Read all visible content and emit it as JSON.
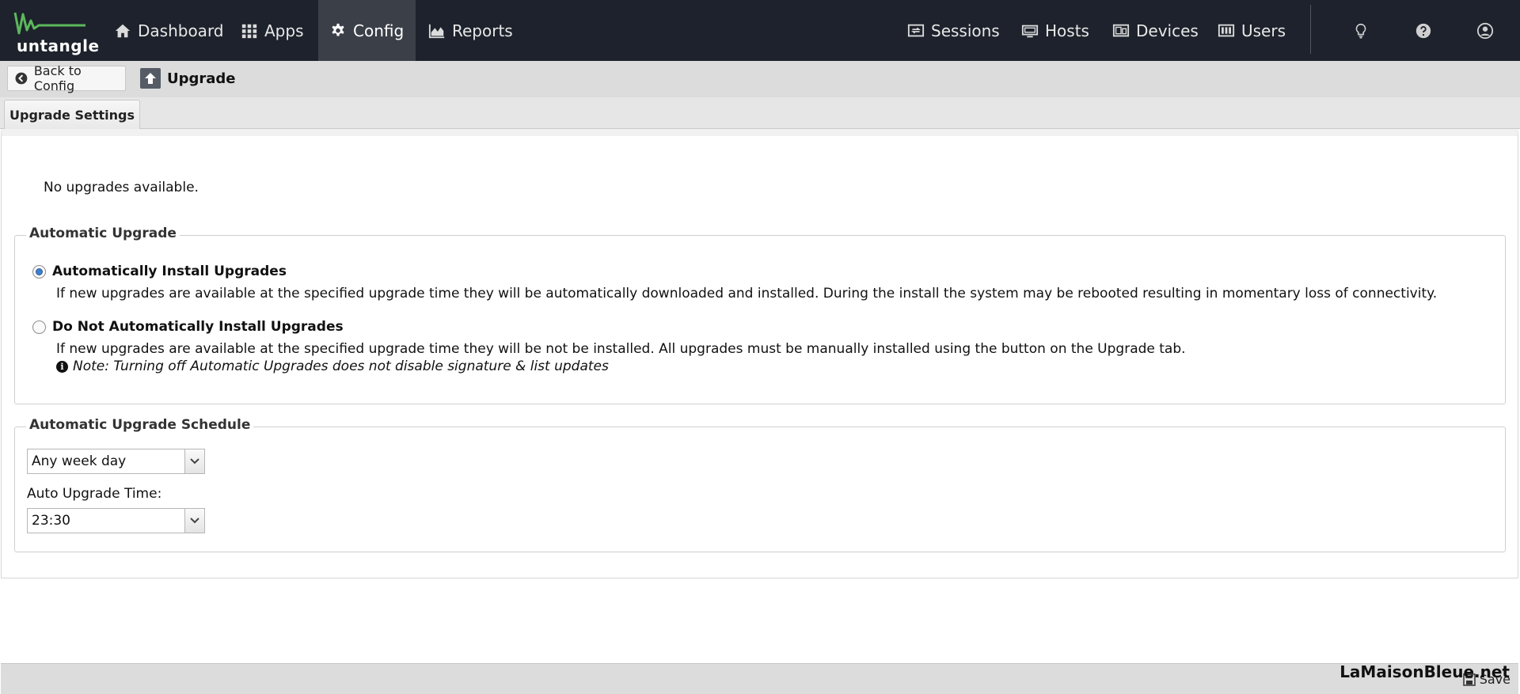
{
  "topbar": {
    "logo_text": "untangle",
    "nav": [
      {
        "label": "Dashboard",
        "icon": "home-icon"
      },
      {
        "label": "Apps",
        "icon": "grid-icon"
      },
      {
        "label": "Config",
        "icon": "gear-icon",
        "active": true
      },
      {
        "label": "Reports",
        "icon": "area-chart-icon"
      }
    ],
    "right_nav": [
      {
        "label": "Sessions",
        "icon": "sessions-icon"
      },
      {
        "label": "Hosts",
        "icon": "hosts-icon"
      },
      {
        "label": "Devices",
        "icon": "devices-icon"
      },
      {
        "label": "Users",
        "icon": "users-icon"
      }
    ],
    "utility_icons": [
      "lightbulb-icon",
      "help-icon",
      "account-icon"
    ],
    "colors": {
      "background": "#1d222c",
      "active": "#3b3f48",
      "logo_green": "#5cb85c"
    }
  },
  "subbar": {
    "back_label": "Back to Config",
    "page_title": "Upgrade"
  },
  "tabs": [
    {
      "label": "Upgrade Settings",
      "active": true
    }
  ],
  "main": {
    "status": "No upgrades available.",
    "automatic_upgrade": {
      "legend": "Automatic Upgrade",
      "options": [
        {
          "label": "Automatically Install Upgrades",
          "checked": true,
          "description": "If new upgrades are available at the specified upgrade time they will be automatically downloaded and installed. During the install the system may be rebooted resulting in momentary loss of connectivity."
        },
        {
          "label": "Do Not Automatically Install Upgrades",
          "checked": false,
          "description": "If new upgrades are available at the specified upgrade time they will be not be installed. All upgrades must be manually installed using the button on the Upgrade tab."
        }
      ],
      "note": "Note: Turning off Automatic Upgrades does not disable signature & list updates"
    },
    "schedule": {
      "legend": "Automatic Upgrade Schedule",
      "day_value": "Any week day",
      "time_label": "Auto Upgrade Time:",
      "time_value": "23:30"
    }
  },
  "footer": {
    "save_label": "Save"
  },
  "watermark": "LaMaisonBleue.net"
}
